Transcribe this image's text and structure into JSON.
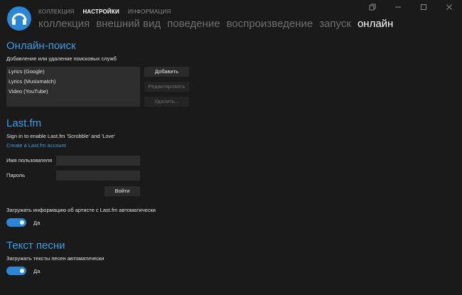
{
  "header": {
    "top_tabs": [
      "КОЛЛЕКЦИЯ",
      "НАСТРОЙКИ",
      "ИНФОРМАЦИЯ"
    ],
    "sub_tabs": [
      "коллекция",
      "внешний вид",
      "поведение",
      "воспроизведение",
      "запуск",
      "онлайн"
    ],
    "active_top": "НАСТРОЙКИ",
    "active_sub": "онлайн"
  },
  "online_search": {
    "title": "Онлайн-поиск",
    "description": "Добавление или удаление поисковых служб",
    "items": [
      "Lyrics (Google)",
      "Lyrics (Musixmatch)",
      "Video (YouTube)"
    ],
    "add_button": "Добавить",
    "edit_button": "Редактировать",
    "delete_button": "Удалить..."
  },
  "lastfm": {
    "title": "Last.fm",
    "description": "Sign in to enable Last.fm 'Scrobble' and 'Love'",
    "create_link": "Create a Last.fm account",
    "username_label": "Имя пользователя",
    "username_value": "",
    "password_label": "Пароль",
    "password_value": "",
    "login_button": "Войти",
    "auto_download_label": "Загружать информацию об артисте с Last.fm автоматически",
    "auto_download_toggle": "Да"
  },
  "lyrics": {
    "title": "Текст песни",
    "auto_download_label": "Загружать тексты песен автоматически",
    "toggle_label": "Да"
  },
  "colors": {
    "background": "#1a1a1a",
    "accent": "#3a9ee4",
    "toggle_on": "#2b86d6"
  },
  "icons": [
    "headphones-logo-icon",
    "restore-window-icon",
    "minimize-icon",
    "maximize-icon",
    "close-icon"
  ]
}
